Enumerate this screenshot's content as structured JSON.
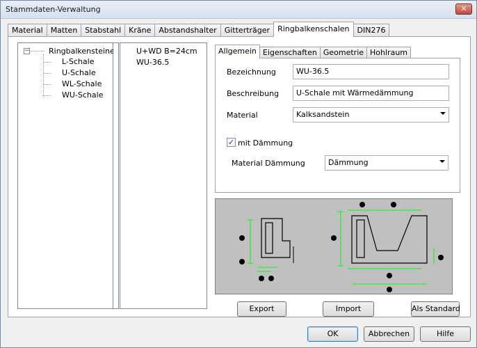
{
  "window": {
    "title": "Stammdaten-Verwaltung",
    "close_glyph": "✕"
  },
  "main_tabs": [
    {
      "label": "Material"
    },
    {
      "label": "Matten"
    },
    {
      "label": "Stabstahl"
    },
    {
      "label": "Kräne"
    },
    {
      "label": "Abstandshalter"
    },
    {
      "label": "Gitterträger"
    },
    {
      "label": "Ringbalkenschalen",
      "active": true
    },
    {
      "label": "DIN276"
    }
  ],
  "tree": {
    "expander_glyph": "−",
    "root": "Ringbalkensteine",
    "children": [
      "L-Schale",
      "U-Schale",
      "WL-Schale",
      "WU-Schale"
    ]
  },
  "list": {
    "items": [
      "U+WD B=24cm",
      "WU-36.5"
    ]
  },
  "detail_tabs": [
    {
      "label": "Allgemein",
      "active": true
    },
    {
      "label": "Eigenschaften"
    },
    {
      "label": "Geometrie"
    },
    {
      "label": "Hohlraum"
    }
  ],
  "form": {
    "bezeichnung_label": "Bezeichnung",
    "bezeichnung_value": "WU-36.5",
    "beschreibung_label": "Beschreibung",
    "beschreibung_value": "U-Schale mit Wärmedämmung",
    "material_label": "Material",
    "material_value": "Kalksandstein",
    "daemmung_check_label": "mit Dämmung",
    "daemmung_checked": true,
    "check_glyph": "✓",
    "material_daemmung_label": "Material Dämmung",
    "material_daemmung_value": "Dämmung"
  },
  "preview_buttons": {
    "export": "Export",
    "import": "Import",
    "standard": "Als Standard"
  },
  "dialog_buttons": {
    "ok": "OK",
    "cancel": "Abbrechen",
    "help": "Hilfe"
  },
  "colors": {
    "dimension": "#00ff00",
    "marker": "#000000",
    "preview_bg": "#c0c0c0"
  }
}
